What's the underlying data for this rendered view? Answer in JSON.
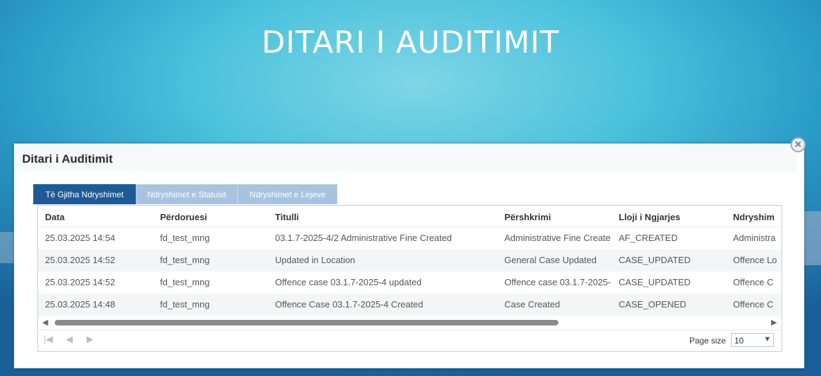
{
  "slide": {
    "title": "DITARI I AUDITIMIT"
  },
  "dialog": {
    "title": "Ditari i Auditimit",
    "close_icon": "close-icon",
    "tabs": [
      {
        "label": "Të Gjitha Ndryshimet",
        "active": true
      },
      {
        "label": "Ndryshimet e Statusit",
        "active": false
      },
      {
        "label": "Ndryshimet e Lejeve",
        "active": false
      }
    ],
    "grid": {
      "columns": [
        "Data",
        "Përdoruesi",
        "Titulli",
        "Përshkrimi",
        "Lloji i Ngjarjes",
        "Ndryshim"
      ],
      "rows": [
        [
          "25.03.2025 14:54",
          "fd_test_mng",
          "03.1.7-2025-4/2 Administrative Fine Created",
          "Administrative Fine Create",
          "AF_CREATED",
          "Administra"
        ],
        [
          "25.03.2025 14:52",
          "fd_test_mng",
          "Updated in Location",
          "General Case Updated",
          "CASE_UPDATED",
          "Offence Lo"
        ],
        [
          "25.03.2025 14:52",
          "fd_test_mng",
          "Offence case 03.1.7-2025-4 updated",
          "Offence case 03.1.7-2025-",
          "CASE_UPDATED",
          "Offence C"
        ],
        [
          "25.03.2025 14:48",
          "fd_test_mng",
          "Offence Case 03.1.7-2025-4 Created",
          "Case Created",
          "CASE_OPENED",
          "Offence C"
        ]
      ],
      "scroll": {
        "left_icon": "scroll-left-icon",
        "right_icon": "scroll-right-icon"
      }
    },
    "pager": {
      "first_icon": "first-page-icon",
      "prev_icon": "prev-page-icon",
      "next_icon": "next-page-icon",
      "page_size_label": "Page size",
      "page_size_value": "10"
    }
  },
  "colors": {
    "tab_active": "#1f5a96",
    "tab_inactive": "#a8c3df"
  }
}
